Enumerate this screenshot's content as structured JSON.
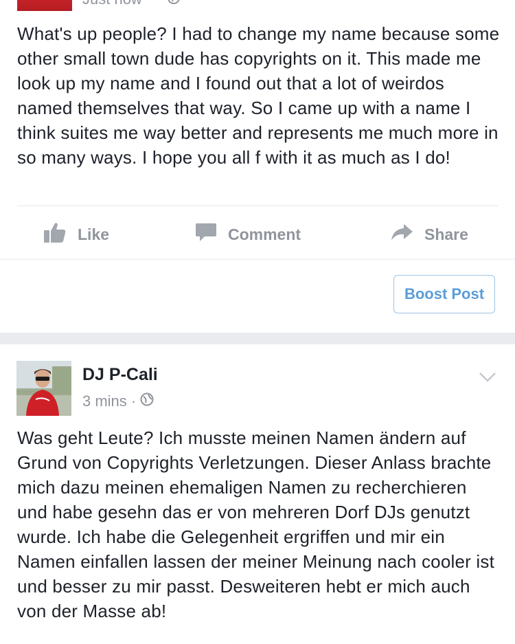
{
  "post1": {
    "time": "Just now",
    "text": "What's up people? I had to change my name because some other small town dude has copyrights on it. This made me look up my name and I found out that a lot of weirdos named themselves that way. So I came up with a name I think suites me way better and represents me much more in so many ways. I hope you all f with it as much as I do!",
    "actions": {
      "like": "Like",
      "comment": "Comment",
      "share": "Share"
    },
    "boost_label": "Boost Post"
  },
  "post2": {
    "author": "DJ P-Cali",
    "time": "3 mins",
    "separator": "·",
    "text": "Was geht Leute? Ich musste meinen Namen ändern auf Grund von Copyrights Verletzungen. Dieser Anlass brachte mich dazu meinen ehemaligen Namen zu recherchieren und habe gesehn das er von mehreren Dorf DJs genutzt wurde. Ich habe die Gelegenheit ergriffen und mir ein Namen einfallen lassen der meiner Meinung nach cooler ist und besser zu mir passt. Desweiteren hebt er mich auch von der Masse ab!"
  },
  "icons": {
    "globe": "globe-icon",
    "like": "thumbs-up-icon",
    "comment": "speech-bubble-icon",
    "share": "share-arrow-icon",
    "menu": "chevron-down-icon"
  },
  "colors": {
    "text": "#1d2129",
    "muted": "#90949c",
    "boost": "#5b9dd9",
    "feed_gap": "#e9ebee"
  }
}
